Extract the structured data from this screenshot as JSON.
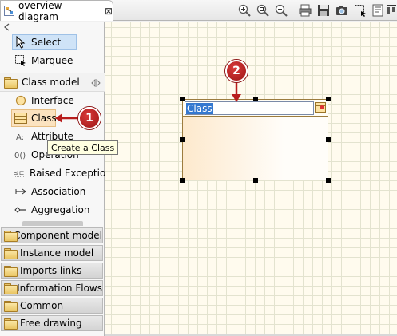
{
  "editor": {
    "tab_title": "overview diagram",
    "close_glyph": "⊠"
  },
  "toolbar": {
    "icons": [
      "zoom-in-icon",
      "zoom-fit-icon",
      "zoom-out-icon",
      "print-icon",
      "save-icon",
      "camera-icon",
      "select-area-icon",
      "properties-icon",
      "align-icon"
    ]
  },
  "palette": {
    "tools": [
      {
        "label": "Select",
        "icon": "cursor-arrow-icon"
      },
      {
        "label": "Marquee",
        "icon": "marquee-icon"
      }
    ],
    "class_model": {
      "label": "Class model",
      "items": [
        {
          "label": "Interface",
          "icon": "interface-icon"
        },
        {
          "label": "Class",
          "icon": "class-icon"
        },
        {
          "label": "Attribute",
          "icon": "attribute-icon"
        },
        {
          "label": "Operation",
          "icon": "operation-icon"
        },
        {
          "label": "Raised Exception",
          "icon": "raised-exception-icon"
        },
        {
          "label": "Association",
          "icon": "association-icon"
        },
        {
          "label": "Aggregation",
          "icon": "aggregation-icon"
        }
      ]
    },
    "drawers": [
      {
        "label": "Component model"
      },
      {
        "label": "Instance model"
      },
      {
        "label": "Imports links"
      },
      {
        "label": "Information Flows"
      },
      {
        "label": "Common"
      },
      {
        "label": "Free drawing"
      }
    ]
  },
  "tooltip": {
    "text": "Create a Class"
  },
  "canvas": {
    "class_element": {
      "name_value": "Class"
    }
  },
  "callouts": [
    {
      "number": "1"
    },
    {
      "number": "2"
    }
  ],
  "colors": {
    "callout_red": "#b81d1d",
    "selection_blue": "#3478d0",
    "class_fill": "#fde9cd",
    "grid_bg": "#fffbee"
  }
}
